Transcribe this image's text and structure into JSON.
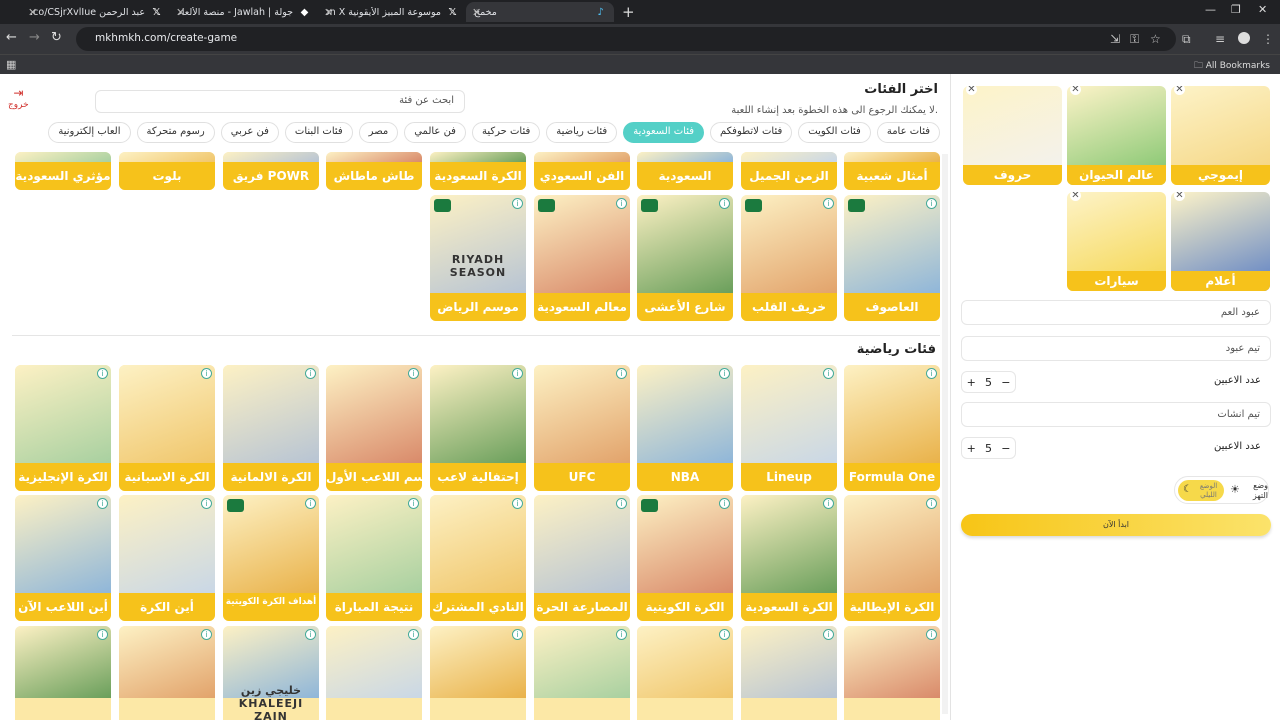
{
  "browser": {
    "tabs": [
      {
        "title": "عبد الرحمن https://t.co/CSjrXvlIue",
        "icon": "x-logo-icon",
        "active": false
      },
      {
        "title": "جولة | Jawlah - منصة الألعاب الت",
        "icon": "jawlah-icon",
        "active": false
      },
      {
        "title": "موسوعة المبيز الأيقونية on X: \"",
        "icon": "x-logo-icon",
        "active": false
      },
      {
        "title": "مخمخ",
        "icon": "mkhmkh-icon",
        "active": true
      }
    ],
    "url": "mkhmkh.com/create-game",
    "bookmarks_label": "All Bookmarks"
  },
  "header": {
    "logout_label": "خروج",
    "search_placeholder": "ابحث عن فئة",
    "title": "اختر الفئات",
    "subtitle": "لا يمكنك الرجوع الى هذه الخطوة بعد إنشاء اللعبة."
  },
  "filters": [
    "فئات عامة",
    "فئات الكويت",
    "فئات لاتطوفكم",
    "فئات السعودية",
    "فئات رياضية",
    "فئات حركية",
    "فن عالمي",
    "مصر",
    "فئات البنات",
    "فن عربي",
    "رسوم متحركة",
    "العاب إلكترونية"
  ],
  "selected_filter": "فئات السعودية",
  "saudi_top_row": [
    "أمثال شعبية",
    "الزمن الجميل",
    "السعودية",
    "الفن السعودي",
    "الكرة السعودية",
    "طاش ماطاش",
    "فريق POWR",
    "بلوت",
    "مؤثري السعودية"
  ],
  "saudi_row2": [
    "العاصوف",
    "خريف القلب",
    "شارع الأعشى",
    "معالم السعودية",
    "موسم الرياض"
  ],
  "riyadh_season_text": "RIYADH SEASON",
  "sports_section_title": "فئات رياضية",
  "sports_row1": [
    "Formula One",
    "Lineup",
    "NBA",
    "UFC",
    "إحتفالية لاعب",
    "إسم اللاعب الأول",
    "الكرة الالمانية",
    "الكرة الاسبانية",
    "الكرة الإنجليزية"
  ],
  "sports_row2": [
    "الكرة الإيطالية",
    "الكرة السعودية",
    "الكرة الكويتية",
    "المصارعة الحرة",
    "النادي المشترك",
    "نتيجة المباراة",
    "أهداف الكرة الكويتية",
    "أين الكرة",
    "أين اللاعب الآن"
  ],
  "sports_row3": [
    "",
    "",
    "",
    "",
    "",
    "",
    "",
    "",
    ""
  ],
  "khaleeji_text": "خليجي زين KHALEEJI ZAIN",
  "selected_categories": [
    "إيموجي",
    "عالم الحيوان",
    "حروف",
    "أعلام",
    "سيارات"
  ],
  "team_form": {
    "team1_placeholder": "عبود العم",
    "team1_name": "تيم عبود",
    "players_label": "عدد الاعبين",
    "team1_players": "5",
    "team2_name": "تيم انشات",
    "team2_players": "5"
  },
  "mode": {
    "label": "وضع التهز",
    "option_active": "الوضع الليلي"
  },
  "start_label": "ابدأ الآن"
}
